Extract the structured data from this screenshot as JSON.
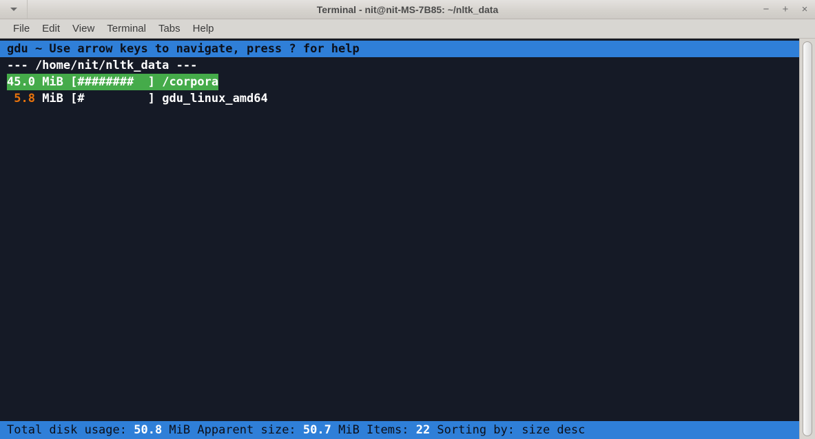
{
  "window": {
    "title": "Terminal - nit@nit-MS-7B85: ~/nltk_data",
    "menu_arrow_icon": "chevron-down-icon",
    "controls": {
      "minimize": "−",
      "maximize": "+",
      "close": "×"
    }
  },
  "menubar": {
    "items": [
      {
        "label": "File"
      },
      {
        "label": "Edit"
      },
      {
        "label": "View"
      },
      {
        "label": "Terminal"
      },
      {
        "label": "Tabs"
      },
      {
        "label": "Help"
      }
    ]
  },
  "terminal": {
    "help_bar": "gdu ~ Use arrow keys to navigate, press ? for help",
    "path_header": "--- /home/nit/nltk_data ---",
    "rows": [
      {
        "size_value": "45.0",
        "size_unit": " MiB ",
        "bar": "[########  ]",
        "name": "/corpora",
        "selected": true,
        "size_color": "#ffffff"
      },
      {
        "size_value": " 5.8",
        "size_unit": " MiB ",
        "bar": "[#         ]",
        "name": "gdu_linux_amd64",
        "selected": false,
        "size_color": "#e8730c"
      }
    ],
    "status": {
      "label_total": "Total disk usage: ",
      "total_value": "50.8",
      "label_total_unit": " MiB ",
      "label_apparent": "Apparent size: ",
      "apparent_value": "50.7",
      "label_apparent_unit": " MiB ",
      "label_items": "Items: ",
      "items_value": "22",
      "label_sorting": " Sorting by: size desc"
    }
  },
  "colors": {
    "terminal_bg": "#151a26",
    "accent_blue": "#2f7fd8",
    "selected_green": "#45ab4a",
    "size_orange": "#e8730c"
  },
  "scrollbar": {
    "name": "vertical-scrollbar"
  }
}
